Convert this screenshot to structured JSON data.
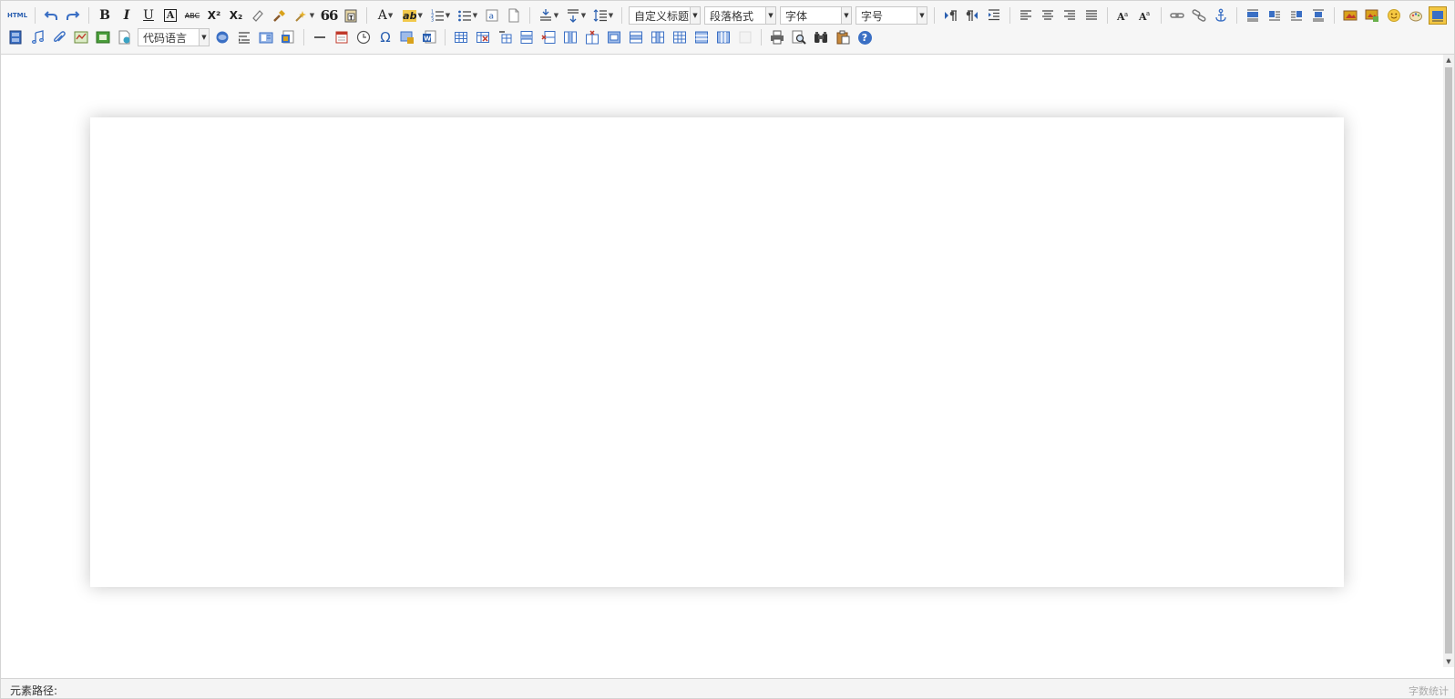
{
  "toolbar": {
    "html_label": "HTML",
    "bold_label": "B",
    "italic_label": "I",
    "underline_label": "U",
    "fontborder_label": "A",
    "strike_label": "ABC",
    "superscript_label": "X²",
    "subscript_label": "X₂",
    "blockquote_label": "66",
    "forecolor_label": "A",
    "backcolor_label": "ab",
    "customstyle": "自定义标题",
    "paragraph": "段落格式",
    "fontfamily": "字体",
    "fontsize": "字号",
    "codelang": "代码语言",
    "omega_label": "Ω",
    "help_label": "?"
  },
  "statusbar": {
    "path_label": "元素路径:",
    "wordcount_label": "字数统计"
  },
  "colors": {
    "toolbar_bg": "#f6f6f6",
    "border": "#d4d4d4",
    "icon_blue": "#3a6fc4",
    "icon_gold": "#d9a21b"
  },
  "icons": [
    "source-icon",
    "undo-icon",
    "redo-icon",
    "bold-icon",
    "italic-icon",
    "underline-icon",
    "fontborder-icon",
    "strikethrough-icon",
    "superscript-icon",
    "subscript-icon",
    "remove-format-icon",
    "format-match-icon",
    "auto-typeset-icon",
    "blockquote-icon",
    "paste-plain-icon",
    "forecolor-icon",
    "backcolor-icon",
    "ordered-list-icon",
    "unordered-list-icon",
    "select-all-icon",
    "clear-doc-icon",
    "row-spacing-top-icon",
    "row-spacing-bottom-icon",
    "line-height-icon",
    "direction-ltr-icon",
    "direction-rtl-icon",
    "indent-icon",
    "justify-left-icon",
    "justify-center-icon",
    "justify-right-icon",
    "justify-full-icon",
    "touppercase-icon",
    "tolowercase-icon",
    "link-icon",
    "unlink-icon",
    "anchor-icon",
    "image-none-icon",
    "image-left-icon",
    "image-right-icon",
    "image-center-icon",
    "simple-upload-icon",
    "insert-image-icon",
    "emotion-icon",
    "scrawl-icon",
    "insert-video-icon",
    "music-icon",
    "attachment-icon",
    "map-icon",
    "gmap-icon",
    "insert-frame-icon",
    "insert-code-icon",
    "page-break-icon",
    "template-icon",
    "background-icon",
    "horizontal-icon",
    "date-icon",
    "time-icon",
    "spechars-icon",
    "wordimage-icon",
    "insert-table-icon",
    "delete-table-icon",
    "insert-paragraph-before-table-icon",
    "insert-row-icon",
    "delete-row-icon",
    "insert-col-icon",
    "delete-col-icon",
    "merge-cells-icon",
    "merge-right-icon",
    "merge-down-icon",
    "split-to-cells-icon",
    "split-to-rows-icon",
    "split-to-cols-icon",
    "charts-icon",
    "print-icon",
    "preview-icon",
    "search-replace-icon",
    "drafts-icon",
    "help-icon"
  ]
}
